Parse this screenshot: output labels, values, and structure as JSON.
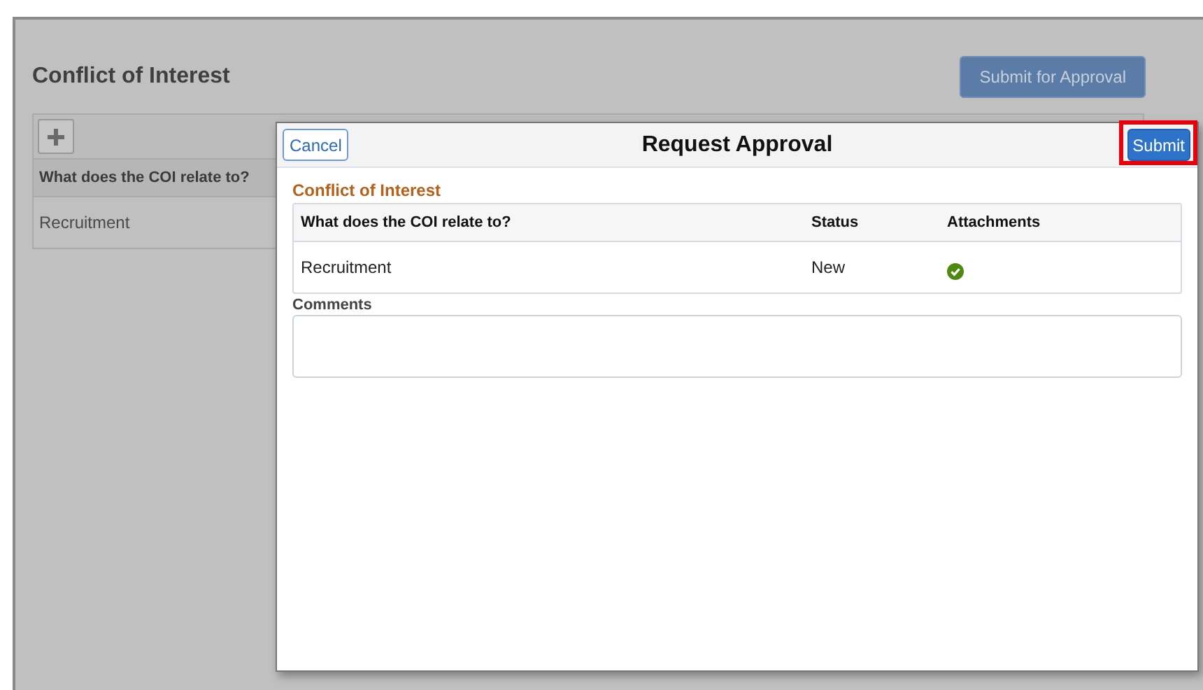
{
  "page": {
    "title": "Conflict of Interest",
    "submit_button": "Submit for Approval",
    "table": {
      "columns": [
        "What does the COI relate to?"
      ],
      "rows": [
        [
          "Recruitment"
        ]
      ]
    }
  },
  "dialog": {
    "cancel": "Cancel",
    "title": "Request Approval",
    "submit": {
      "label": "Submit",
      "highlighted": true
    },
    "section_title": "Conflict of Interest",
    "table": {
      "columns": [
        "What does the COI relate to?",
        "Status",
        "Attachments"
      ],
      "rows": [
        {
          "cells": [
            "Recruitment",
            "New"
          ],
          "attachment": true
        }
      ]
    },
    "comments": {
      "label": "Comments"
    }
  }
}
